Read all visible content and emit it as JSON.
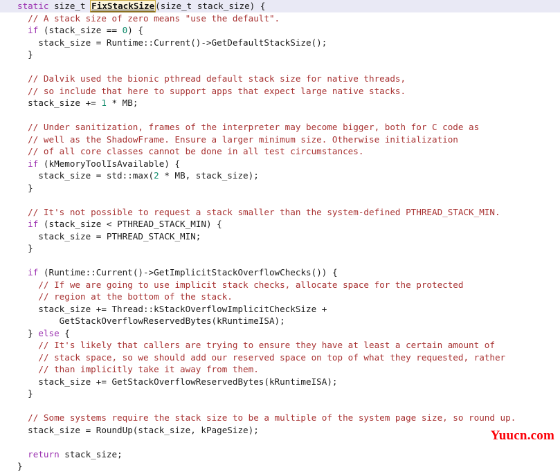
{
  "viewer": {
    "name": "source-code-view",
    "language": "C++",
    "colors": {
      "background": "#ffffff",
      "foreground": "#1a1a1a",
      "keyword": "#9b30b0",
      "comment": "#a83232",
      "number": "#0f8a6a",
      "highlight_line_background": "#e9e9f5",
      "symbol_box_background": "#fdf6dd",
      "symbol_box_border": "#c9a940",
      "watermark": "#fb0007"
    }
  },
  "watermark": {
    "text": "Yuucn.com"
  },
  "code": {
    "lines": [
      {
        "highlight": true,
        "tokens": [
          {
            "t": "kw",
            "s": "static"
          },
          {
            "t": "plain",
            "s": " size_t "
          },
          {
            "t": "sym",
            "s": "FixStackSize"
          },
          {
            "t": "plain",
            "s": "(size_t stack_size) {"
          }
        ]
      },
      {
        "tokens": [
          {
            "t": "cmt",
            "s": "  // A stack size of zero means \"use the default\"."
          }
        ]
      },
      {
        "tokens": [
          {
            "t": "plain",
            "s": "  "
          },
          {
            "t": "kw",
            "s": "if"
          },
          {
            "t": "plain",
            "s": " (stack_size == "
          },
          {
            "t": "num",
            "s": "0"
          },
          {
            "t": "plain",
            "s": ") {"
          }
        ]
      },
      {
        "tokens": [
          {
            "t": "plain",
            "s": "    stack_size = Runtime::Current()->GetDefaultStackSize();"
          }
        ]
      },
      {
        "tokens": [
          {
            "t": "plain",
            "s": "  }"
          }
        ]
      },
      {
        "tokens": [
          {
            "t": "plain",
            "s": ""
          }
        ]
      },
      {
        "tokens": [
          {
            "t": "cmt",
            "s": "  // Dalvik used the bionic pthread default stack size for native threads,"
          }
        ]
      },
      {
        "tokens": [
          {
            "t": "cmt",
            "s": "  // so include that here to support apps that expect large native stacks."
          }
        ]
      },
      {
        "tokens": [
          {
            "t": "plain",
            "s": "  stack_size += "
          },
          {
            "t": "num",
            "s": "1"
          },
          {
            "t": "plain",
            "s": " * MB;"
          }
        ]
      },
      {
        "tokens": [
          {
            "t": "plain",
            "s": ""
          }
        ]
      },
      {
        "tokens": [
          {
            "t": "cmt",
            "s": "  // Under sanitization, frames of the interpreter may become bigger, both for C code as"
          }
        ]
      },
      {
        "tokens": [
          {
            "t": "cmt",
            "s": "  // well as the ShadowFrame. Ensure a larger minimum size. Otherwise initialization"
          }
        ]
      },
      {
        "tokens": [
          {
            "t": "cmt",
            "s": "  // of all core classes cannot be done in all test circumstances."
          }
        ]
      },
      {
        "tokens": [
          {
            "t": "plain",
            "s": "  "
          },
          {
            "t": "kw",
            "s": "if"
          },
          {
            "t": "plain",
            "s": " (kMemoryToolIsAvailable) {"
          }
        ]
      },
      {
        "tokens": [
          {
            "t": "plain",
            "s": "    stack_size = std::max("
          },
          {
            "t": "num",
            "s": "2"
          },
          {
            "t": "plain",
            "s": " * MB, stack_size);"
          }
        ]
      },
      {
        "tokens": [
          {
            "t": "plain",
            "s": "  }"
          }
        ]
      },
      {
        "tokens": [
          {
            "t": "plain",
            "s": ""
          }
        ]
      },
      {
        "tokens": [
          {
            "t": "cmt",
            "s": "  // It's not possible to request a stack smaller than the system-defined PTHREAD_STACK_MIN."
          }
        ]
      },
      {
        "tokens": [
          {
            "t": "plain",
            "s": "  "
          },
          {
            "t": "kw",
            "s": "if"
          },
          {
            "t": "plain",
            "s": " (stack_size < PTHREAD_STACK_MIN) {"
          }
        ]
      },
      {
        "tokens": [
          {
            "t": "plain",
            "s": "    stack_size = PTHREAD_STACK_MIN;"
          }
        ]
      },
      {
        "tokens": [
          {
            "t": "plain",
            "s": "  }"
          }
        ]
      },
      {
        "tokens": [
          {
            "t": "plain",
            "s": ""
          }
        ]
      },
      {
        "tokens": [
          {
            "t": "plain",
            "s": "  "
          },
          {
            "t": "kw",
            "s": "if"
          },
          {
            "t": "plain",
            "s": " (Runtime::Current()->GetImplicitStackOverflowChecks()) {"
          }
        ]
      },
      {
        "tokens": [
          {
            "t": "cmt",
            "s": "    // If we are going to use implicit stack checks, allocate space for the protected"
          }
        ]
      },
      {
        "tokens": [
          {
            "t": "cmt",
            "s": "    // region at the bottom of the stack."
          }
        ]
      },
      {
        "tokens": [
          {
            "t": "plain",
            "s": "    stack_size += Thread::kStackOverflowImplicitCheckSize +"
          }
        ]
      },
      {
        "tokens": [
          {
            "t": "plain",
            "s": "        GetStackOverflowReservedBytes(kRuntimeISA);"
          }
        ]
      },
      {
        "tokens": [
          {
            "t": "plain",
            "s": "  } "
          },
          {
            "t": "kw",
            "s": "else"
          },
          {
            "t": "plain",
            "s": " {"
          }
        ]
      },
      {
        "tokens": [
          {
            "t": "cmt",
            "s": "    // It's likely that callers are trying to ensure they have at least a certain amount of"
          }
        ]
      },
      {
        "tokens": [
          {
            "t": "cmt",
            "s": "    // stack space, so we should add our reserved space on top of what they requested, rather"
          }
        ]
      },
      {
        "tokens": [
          {
            "t": "cmt",
            "s": "    // than implicitly take it away from them."
          }
        ]
      },
      {
        "tokens": [
          {
            "t": "plain",
            "s": "    stack_size += GetStackOverflowReservedBytes(kRuntimeISA);"
          }
        ]
      },
      {
        "tokens": [
          {
            "t": "plain",
            "s": "  }"
          }
        ]
      },
      {
        "tokens": [
          {
            "t": "plain",
            "s": ""
          }
        ]
      },
      {
        "tokens": [
          {
            "t": "cmt",
            "s": "  // Some systems require the stack size to be a multiple of the system page size, so round up."
          }
        ]
      },
      {
        "tokens": [
          {
            "t": "plain",
            "s": "  stack_size = RoundUp(stack_size, kPageSize);"
          }
        ]
      },
      {
        "tokens": [
          {
            "t": "plain",
            "s": ""
          }
        ]
      },
      {
        "tokens": [
          {
            "t": "plain",
            "s": "  "
          },
          {
            "t": "kw",
            "s": "return"
          },
          {
            "t": "plain",
            "s": " stack_size;"
          }
        ]
      },
      {
        "tokens": [
          {
            "t": "plain",
            "s": "}"
          }
        ]
      }
    ]
  }
}
